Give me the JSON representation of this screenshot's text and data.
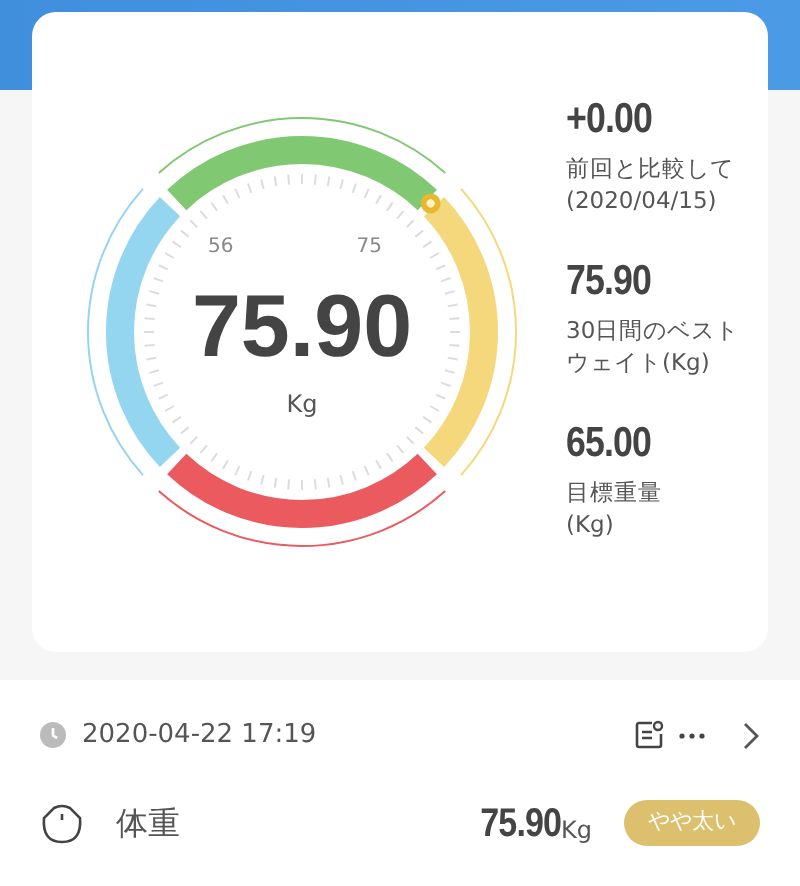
{
  "gauge": {
    "value": "75.90",
    "unit": "Kg",
    "scale_labels": [
      "56",
      "75"
    ],
    "segments": [
      {
        "color": "#80c872"
      },
      {
        "color": "#f5d77c"
      },
      {
        "color": "#ea5a5f"
      },
      {
        "color": "#94d5f0"
      }
    ]
  },
  "stats": [
    {
      "value": "+0.00",
      "label": [
        "前回と比較して",
        "(2020/04/15)"
      ]
    },
    {
      "value": "75.90",
      "label": [
        "30日間のベスト",
        "ウェイト(Kg)"
      ]
    },
    {
      "value": "65.00",
      "label": [
        "目標重量",
        "(Kg)"
      ]
    }
  ],
  "record": {
    "datetime": "2020-04-22 17:19"
  },
  "measurement": {
    "name": "体重",
    "value": "75.90",
    "unit": "Kg",
    "status": "やや太い"
  }
}
